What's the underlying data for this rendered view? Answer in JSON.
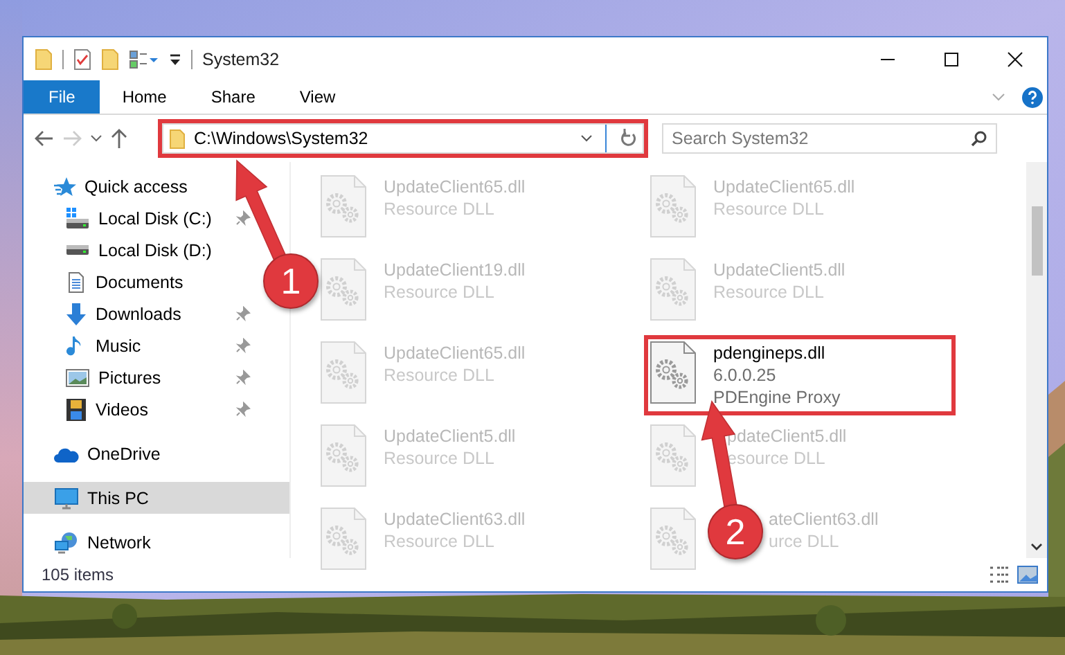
{
  "window": {
    "title": "System32"
  },
  "ribbon_tabs": [
    {
      "label": "File",
      "kind": "file"
    },
    {
      "label": "Home",
      "kind": "tab"
    },
    {
      "label": "Share",
      "kind": "tab"
    },
    {
      "label": "View",
      "kind": "tab"
    }
  ],
  "address": {
    "path": "C:\\Windows\\System32",
    "boxed": true
  },
  "search": {
    "placeholder": "Search System32"
  },
  "nav": [
    {
      "label": "Quick access",
      "selected": false,
      "children": [
        {
          "label": "Local Disk (C:)",
          "selected": false,
          "pinned": true
        },
        {
          "label": "Local Disk (D:)",
          "selected": false,
          "pinned": false
        },
        {
          "label": "Documents",
          "selected": false,
          "pinned": false
        },
        {
          "label": "Downloads",
          "selected": false,
          "pinned": true
        },
        {
          "label": "Music",
          "selected": false,
          "pinned": true
        },
        {
          "label": "Pictures",
          "selected": false,
          "pinned": true
        },
        {
          "label": "Videos",
          "selected": false,
          "pinned": true
        }
      ]
    },
    {
      "label": "OneDrive",
      "selected": false
    },
    {
      "label": "This PC",
      "selected": true
    },
    {
      "label": "Network",
      "selected": false
    }
  ],
  "files": [
    {
      "name": "UpdateClient65.dll",
      "description": "Resource DLL",
      "blurred": true,
      "boxed": false
    },
    {
      "name": "UpdateClient65.dll",
      "description": "Resource DLL",
      "blurred": true,
      "boxed": false
    },
    {
      "name": "UpdateClient19.dll",
      "description": "Resource DLL",
      "blurred": true,
      "boxed": false
    },
    {
      "name": "UpdateClient5.dll",
      "description": "Resource DLL",
      "blurred": true,
      "boxed": false
    },
    {
      "name": "UpdateClient65.dll",
      "description": "Resource DLL",
      "blurred": true,
      "boxed": false
    },
    {
      "name": "pdengineps.dll",
      "version": "6.0.0.25",
      "description": "PDEngine Proxy",
      "blurred": false,
      "boxed": true
    },
    {
      "name": "UpdateClient5.dll",
      "description": "Resource DLL",
      "blurred": true,
      "boxed": false
    },
    {
      "name": "pdateClient5.dll",
      "description": "esource DLL",
      "blurred": true,
      "boxed": false
    },
    {
      "name": "UpdateClient63.dll",
      "description": "Resource DLL",
      "blurred": true,
      "boxed": false
    },
    {
      "name": "ateClient63.dll",
      "description": "urce DLL",
      "blurred": true,
      "boxed": false
    }
  ],
  "status_bar": {
    "item_count": "105 items"
  },
  "callouts": [
    {
      "number": "1"
    },
    {
      "number": "2"
    }
  ]
}
